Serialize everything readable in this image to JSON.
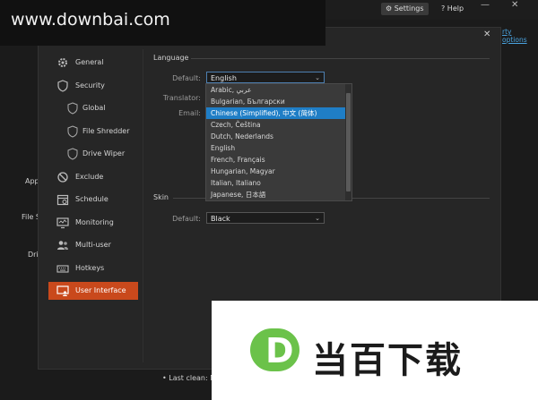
{
  "watermark": {
    "site": "www.downbai.com",
    "logo_letter": "D",
    "logo_text": "当百下载"
  },
  "topbar": {
    "settings_label": "Settings",
    "help_label": "Help",
    "options_link": "rty options"
  },
  "background": {
    "labels": [
      "App",
      "File S",
      "Dri"
    ],
    "last_clean": "• Last clean: N/"
  },
  "sidebar": {
    "items": [
      {
        "label": "General",
        "icon": "gear-icon"
      },
      {
        "label": "Security",
        "icon": "shield-icon"
      },
      {
        "label": "Global",
        "icon": "shield-outline-icon"
      },
      {
        "label": "File Shredder",
        "icon": "shield-outline-icon"
      },
      {
        "label": "Drive Wiper",
        "icon": "shield-outline-icon"
      },
      {
        "label": "Exclude",
        "icon": "block-icon"
      },
      {
        "label": "Schedule",
        "icon": "calendar-icon"
      },
      {
        "label": "Monitoring",
        "icon": "monitor-icon"
      },
      {
        "label": "Multi-user",
        "icon": "users-icon"
      },
      {
        "label": "Hotkeys",
        "icon": "keyboard-icon"
      },
      {
        "label": "User Interface",
        "icon": "user-interface-icon"
      }
    ]
  },
  "language": {
    "section_title": "Language",
    "default_label": "Default:",
    "default_value": "English",
    "translator_label": "Translator:",
    "email_label": "Email:",
    "options": [
      "Arabic, عربي",
      "Bulgarian, Български",
      "Chinese (Simplified), 中文 (简体)",
      "Czech, Čeština",
      "Dutch, Nederlands",
      "English",
      "French, Français",
      "Hungarian, Magyar",
      "Italian, Italiano",
      "Japanese, 日本語"
    ],
    "selected_option": "Chinese (Simplified), 中文 (简体)"
  },
  "skin": {
    "section_title": "Skin",
    "default_label": "Default:",
    "default_value": "Black"
  },
  "colors": {
    "accent": "#c9491c",
    "selection": "#1f7ec6",
    "logo_green": "#6bc24a"
  }
}
